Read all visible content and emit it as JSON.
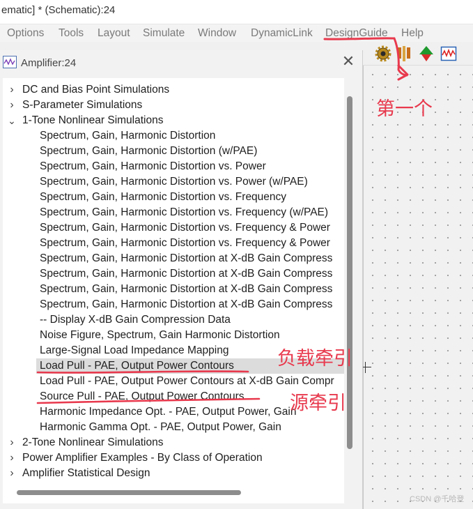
{
  "window": {
    "title": "ematic] * (Schematic):24"
  },
  "menu": [
    {
      "label": "Options",
      "name": "menu-options"
    },
    {
      "label": "Tools",
      "name": "menu-tools"
    },
    {
      "label": "Layout",
      "name": "menu-layout"
    },
    {
      "label": "Simulate",
      "name": "menu-simulate"
    },
    {
      "label": "Window",
      "name": "menu-window"
    },
    {
      "label": "DynamicLink",
      "name": "menu-dynamiclink"
    },
    {
      "label": "DesignGuide",
      "name": "menu-designguide"
    },
    {
      "label": "Help",
      "name": "menu-help"
    }
  ],
  "toolbar": {
    "icons": [
      "designguide-gear-icon",
      "probe-icon",
      "green-red-arrow-icon",
      "waveform-icon"
    ]
  },
  "dialog": {
    "title": "Amplifier:24",
    "close_label": "✕",
    "tree": [
      {
        "label": "DC and Bias Point Simulations",
        "level": 0,
        "expander": "collapsed"
      },
      {
        "label": "S-Parameter Simulations",
        "level": 0,
        "expander": "collapsed"
      },
      {
        "label": "1-Tone Nonlinear Simulations",
        "level": 0,
        "expander": "expanded"
      },
      {
        "label": "Spectrum, Gain, Harmonic Distortion",
        "level": 1
      },
      {
        "label": "Spectrum, Gain, Harmonic Distortion (w/PAE)",
        "level": 1
      },
      {
        "label": "Spectrum, Gain, Harmonic Distortion vs. Power",
        "level": 1
      },
      {
        "label": "Spectrum, Gain, Harmonic Distortion vs. Power (w/PAE)",
        "level": 1
      },
      {
        "label": "Spectrum, Gain, Harmonic Distortion vs. Frequency",
        "level": 1
      },
      {
        "label": "Spectrum, Gain, Harmonic Distortion vs. Frequency (w/PAE)",
        "level": 1
      },
      {
        "label": "Spectrum, Gain, Harmonic Distortion vs. Frequency & Power",
        "level": 1
      },
      {
        "label": "Spectrum, Gain, Harmonic Distortion vs. Frequency & Power",
        "level": 1
      },
      {
        "label": "Spectrum, Gain, Harmonic Distortion at X-dB Gain Compress",
        "level": 1
      },
      {
        "label": "Spectrum, Gain, Harmonic Distortion at X-dB Gain Compress",
        "level": 1
      },
      {
        "label": "Spectrum, Gain, Harmonic Distortion at X-dB Gain Compress",
        "level": 1
      },
      {
        "label": "Spectrum, Gain, Harmonic Distortion at X-dB Gain Compress",
        "level": 1
      },
      {
        "label": "-- Display X-dB Gain Compression Data",
        "level": 1
      },
      {
        "label": "Noise Figure, Spectrum, Gain Harmonic Distortion",
        "level": 1
      },
      {
        "label": "Large-Signal Load Impedance Mapping",
        "level": 1
      },
      {
        "label": "Load Pull - PAE, Output Power Contours",
        "level": 1,
        "selected": true
      },
      {
        "label": "Load Pull - PAE, Output Power Contours at X-dB Gain Compr",
        "level": 1
      },
      {
        "label": "Source Pull - PAE, Output Power Contours",
        "level": 1
      },
      {
        "label": "Harmonic Impedance Opt. - PAE, Output Power, Gain",
        "level": 1
      },
      {
        "label": "Harmonic Gamma Opt. - PAE, Output Power, Gain",
        "level": 1
      },
      {
        "label": "2-Tone Nonlinear Simulations",
        "level": 0,
        "expander": "collapsed"
      },
      {
        "label": "Power Amplifier Examples - By Class of Operation",
        "level": 0,
        "expander": "collapsed"
      },
      {
        "label": "Amplifier Statistical Design",
        "level": 0,
        "expander": "collapsed"
      }
    ]
  },
  "annotations": {
    "first": "第一个",
    "load_pull": "负载牵引",
    "source_pull": "源牵引",
    "color": "#e8394d"
  },
  "watermark": "CSDN @千哈登"
}
